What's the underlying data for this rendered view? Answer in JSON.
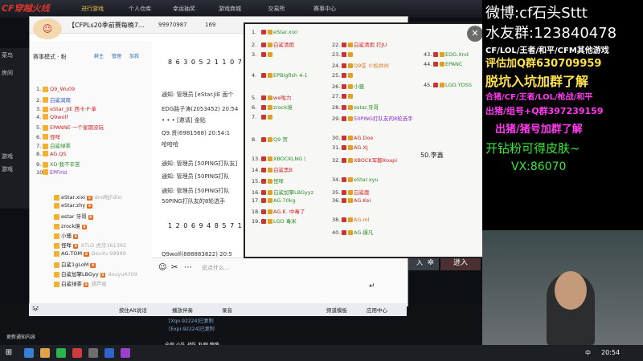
{
  "game": {
    "logo": "CF穿越火线",
    "tabs": [
      "进行游戏",
      "个人仓库",
      "幸运抽奖",
      "游戏商城",
      "交易所",
      "赛事中心"
    ],
    "left_strip": [
      "菜鸟",
      "房间",
      "游戏",
      "游戏"
    ],
    "enter_room": "入",
    "enter_button": "进入",
    "bottom_notice": "更新通知内容",
    "log_line1": "[Xqo-92224]已复制",
    "log_line2": "[Expi-92224]已复制",
    "bottom_tabs": "全部  小队  战队  私聊  悄悄"
  },
  "qq": {
    "group_name": "【CFPLs20季前赛每晚7...",
    "group_id": "99970987",
    "member_count": "169",
    "member_header": "赛事模式 · 粉",
    "header_links": [
      "群主",
      "管理",
      "加我"
    ],
    "members_top": [
      {
        "rank": "1.",
        "name": "Q9_Wu09",
        "color": "red"
      },
      {
        "rank": "2.",
        "name": "白鲨润周",
        "color": "blue"
      },
      {
        "rank": "3.",
        "name": "eStar_JiE 西卡·P·革",
        "color": "red"
      },
      {
        "rank": "4.",
        "name": "Q9wolf",
        "color": "red"
      },
      {
        "rank": "5.",
        "name": "EPANNE 一个星期没玩",
        "color": "red"
      },
      {
        "rank": "6.",
        "name": "怪咩",
        "color": "red"
      },
      {
        "rank": "7.",
        "name": "白鲨绿茶",
        "color": "green"
      },
      {
        "rank": "8.",
        "name": "AG.QS",
        "color": "red"
      },
      {
        "rank": "9.",
        "name": "XD·我不辛苦",
        "color": "green"
      },
      {
        "rank": "10.",
        "name": "EPFirst",
        "color": "purple"
      }
    ],
    "members_list": [
      {
        "name": "eStar.xixi",
        "extra": "dnd啦Fdlxi"
      },
      {
        "name": "eStar.zhy",
        "extra": ""
      },
      {
        "name": "estar 牙哥",
        "extra": ""
      },
      {
        "name": "zrock境",
        "extra": ""
      },
      {
        "name": "小骚",
        "extra": ""
      },
      {
        "name": "怪咩",
        "extra": "XTLO 虎牙161392"
      },
      {
        "name": "AG.TOM",
        "extra": "DouYu 99999"
      },
      {
        "name": "白鲨1gLoM",
        "extra": ""
      },
      {
        "name": "白鲨加擎LBGyy",
        "extra": "douyu4709"
      },
      {
        "name": "白鲨绿茶",
        "extra": "葫芦星"
      }
    ],
    "chat_lines": [
      {
        "text": "8 6 3 0 5 2 1 1 0 7 4",
        "kind": "num"
      },
      {
        "text": "通知: 管理员 [eStar.JiE 面个",
        "kind": "line"
      },
      {
        "text": "EDG路子涛(2053452) 20:54",
        "kind": "line"
      },
      {
        "text": "• • •  [邀请]  金贴",
        "kind": "line"
      },
      {
        "text": "Q9.贤(6981568)  20:54:1",
        "kind": "line"
      },
      {
        "text": "哈哈哈",
        "kind": "line"
      },
      {
        "text": "通知: 管理员 [50PING打队友]",
        "kind": "line"
      },
      {
        "text": "通知: 管理员 [50PING打队",
        "kind": "line"
      },
      {
        "text": "通知: 管理员 [50PING打队",
        "kind": "line"
      },
      {
        "text": "50PING打队友的8轮选手",
        "kind": "line"
      },
      {
        "text": "1 2 0 6 9 4 8 5 7 1 0",
        "kind": "num"
      },
      {
        "text": "Q9wolf(888883822) 20:5",
        "kind": "line"
      },
      {
        "text": "hhh",
        "kind": "line"
      }
    ],
    "input_placeholder": "说点什么...",
    "toolbar": [
      "按住Alt说话",
      "播放伴奏",
      "录音",
      "频道模板",
      "应用中心"
    ]
  },
  "popup": {
    "rows": [
      {
        "n": "1.",
        "name": "eStar.xixi",
        "color": "green"
      },
      {
        "n": "2.",
        "name": "白鲨清雨",
        "color": "red"
      },
      {
        "n": "3.",
        "name": "",
        "color": "green"
      },
      {
        "n": "4.",
        "name": "EPBigfish 4-1",
        "color": "green"
      },
      {
        "n": "5.",
        "name": "we啦力",
        "color": "red"
      },
      {
        "n": "6.",
        "name": "zrock境",
        "color": "green"
      },
      {
        "n": "7.",
        "name": "",
        "color": "green"
      },
      {
        "n": "8.",
        "name": "Q9 贺",
        "color": "green"
      },
      {
        "n": "13.",
        "name": "XBOCKLNG \\",
        "color": "green"
      },
      {
        "n": "14.",
        "name": "白鲨黑B",
        "color": "red"
      },
      {
        "n": "15.",
        "name": "怪咩",
        "color": "green"
      },
      {
        "n": "16.",
        "name": "白鲨加擎LBGyyz",
        "color": "green"
      },
      {
        "n": "17.",
        "name": "AG.70kg",
        "color": "green"
      },
      {
        "n": "18.",
        "name": "AG.K. 中毒了",
        "color": "red"
      },
      {
        "n": "19.",
        "name": "LGD 毒米",
        "color": "green"
      }
    ],
    "rows_mid": [
      {
        "n": "22.",
        "name": "白鲨清雨 打JU",
        "color": "red"
      },
      {
        "n": "23.",
        "name": "",
        "color": "green"
      },
      {
        "n": "24.",
        "name": "Q9弦 ©松井州",
        "color": "orange"
      },
      {
        "n": "25.",
        "name": "",
        "color": "green"
      },
      {
        "n": "26.",
        "name": "小骚",
        "color": "green"
      },
      {
        "n": "27.",
        "name": "",
        "color": "green"
      },
      {
        "n": "28.",
        "name": "estar.牙哥",
        "color": "green"
      },
      {
        "n": "29.",
        "name": "50PING打队友的8轮选手",
        "color": "purple"
      },
      {
        "n": "30.",
        "name": "AG.Doe",
        "color": "red"
      },
      {
        "n": "31.",
        "name": "AG.XJ",
        "color": "red"
      },
      {
        "n": "32.",
        "name": "XBOCK军翻Xoapi",
        "color": "red"
      },
      {
        "n": "34.",
        "name": "eStar.xyu",
        "color": "green"
      },
      {
        "n": "35.",
        "name": "白鲨鹿",
        "color": "red"
      },
      {
        "n": "36.",
        "name": "AG.Kei",
        "color": "red"
      },
      {
        "n": "38.",
        "name": "AG.ml",
        "color": "orange"
      },
      {
        "n": "40.",
        "name": "AG.僵凡",
        "color": "green"
      }
    ],
    "rows_right": [
      {
        "n": "43.",
        "name": "EDG.Xnd",
        "color": "green"
      },
      {
        "n": "44.",
        "name": "EPANC",
        "color": "green"
      },
      {
        "n": "45.",
        "name": "LGD.YDSS",
        "color": "green"
      }
    ],
    "note": "50.李鑫"
  },
  "overlay": {
    "weibo": "微博:cf石头Sttt",
    "fan_group": "水友群:123840478",
    "games": "CF/LOL/王者/和平/CFM其他游戏",
    "price_group": "评估加Q群630709959",
    "pit": "脱坑入坑加群了解",
    "coop": "合猪/CF/王者/LOL/枪战/和平",
    "pig": "出猪/组号+Q群397239159",
    "pig2": "出猪/猪号加群了解",
    "drill": "开钻粉可得皮肤~",
    "vx": "VX:86070"
  },
  "taskbar": {
    "start_icon": "⊞",
    "lang": "中",
    "time": "20:54"
  },
  "colors": {
    "overlay_white": "#ffffff",
    "overlay_red": "#ff2a2a",
    "overlay_magenta": "#ff3af0",
    "overlay_green": "#36e836",
    "overlay_yellow": "#f5e23a"
  }
}
